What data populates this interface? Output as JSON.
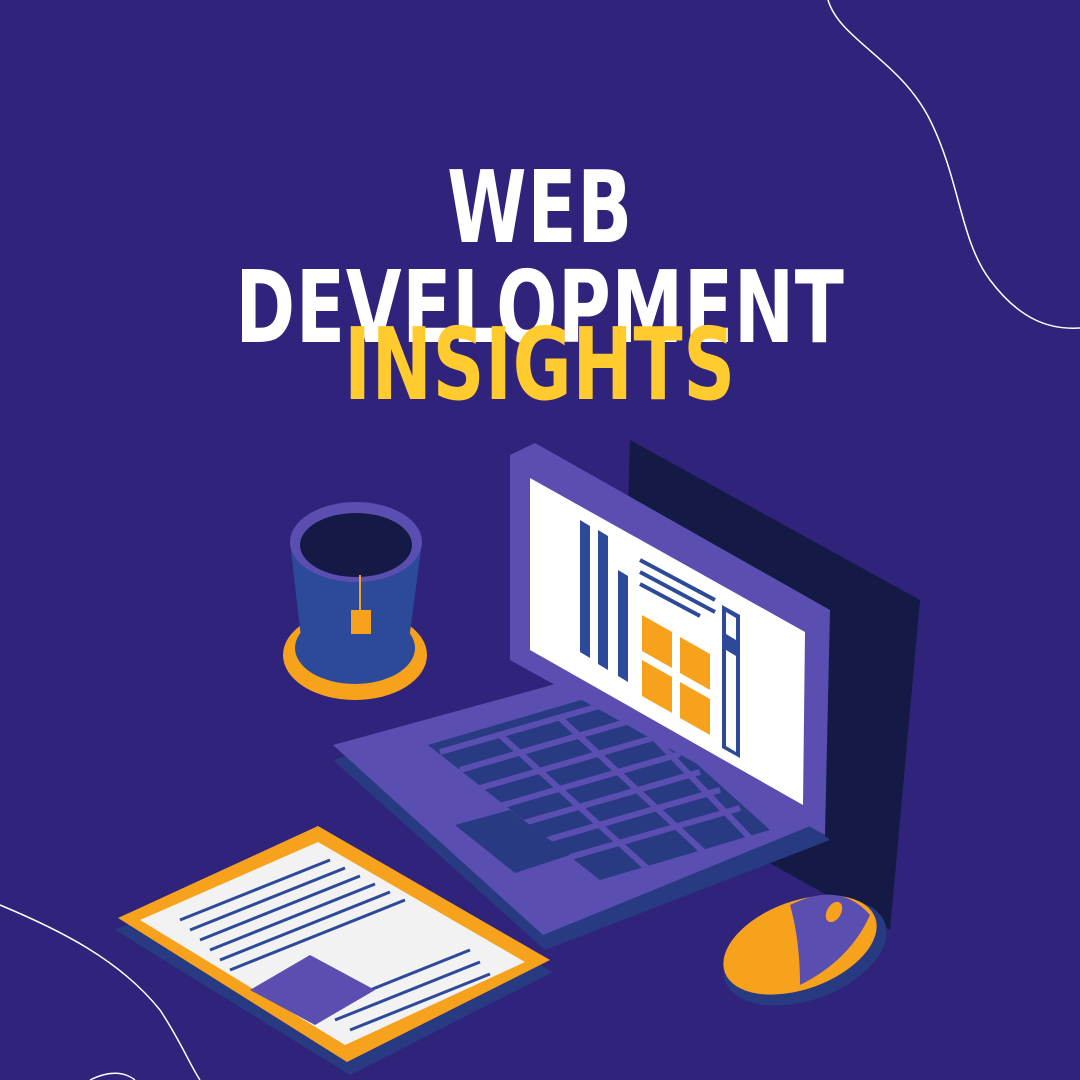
{
  "title": {
    "line1": "WEB DEVELOPMENT",
    "line2": "INSIGHTS"
  },
  "colors": {
    "background": "#2f237b",
    "title_primary": "#ffffff",
    "title_accent": "#ffcb2e",
    "laptop_body": "#5a4fb0",
    "laptop_dark": "#141a45",
    "keyboard": "#283a82",
    "orange": "#f7a21d",
    "screen": "#ffffff",
    "cup": "#2d4a9a"
  },
  "illustration": {
    "icons": [
      "laptop-icon",
      "tea-cup-icon",
      "tablet-icon",
      "mouse-icon"
    ]
  }
}
